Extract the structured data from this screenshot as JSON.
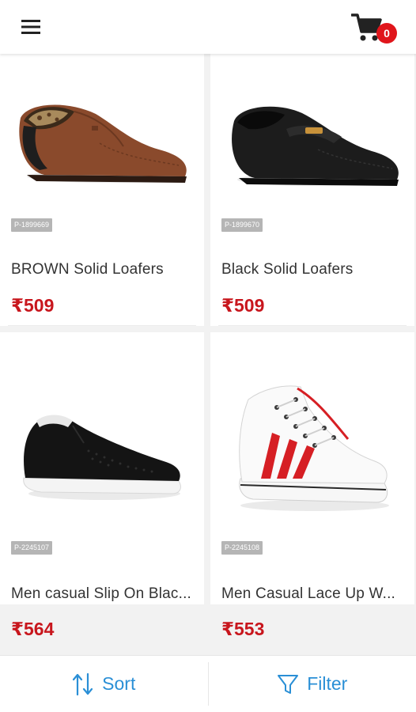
{
  "header": {
    "menu_icon": "hamburger-menu-icon",
    "cart_icon": "shopping-cart-icon",
    "cart_count": "0"
  },
  "products": [
    {
      "sku": "P-1899669",
      "title": "BROWN Solid Loafers",
      "price": "₹509"
    },
    {
      "sku": "P-1899670",
      "title": "Black Solid Loafers",
      "price": "₹509"
    },
    {
      "sku": "P-2245107",
      "title": "Men casual Slip On Blac...",
      "price": "₹564"
    },
    {
      "sku": "P-2245108",
      "title": "Men Casual Lace Up W...",
      "price": "₹553"
    }
  ],
  "bottom_bar": {
    "sort_label": "Sort",
    "sort_icon": "sort-arrows-icon",
    "filter_label": "Filter",
    "filter_icon": "funnel-filter-icon"
  },
  "colors": {
    "accent": "#2a8fd6",
    "price": "#c8161d",
    "badge": "#e0151b"
  }
}
